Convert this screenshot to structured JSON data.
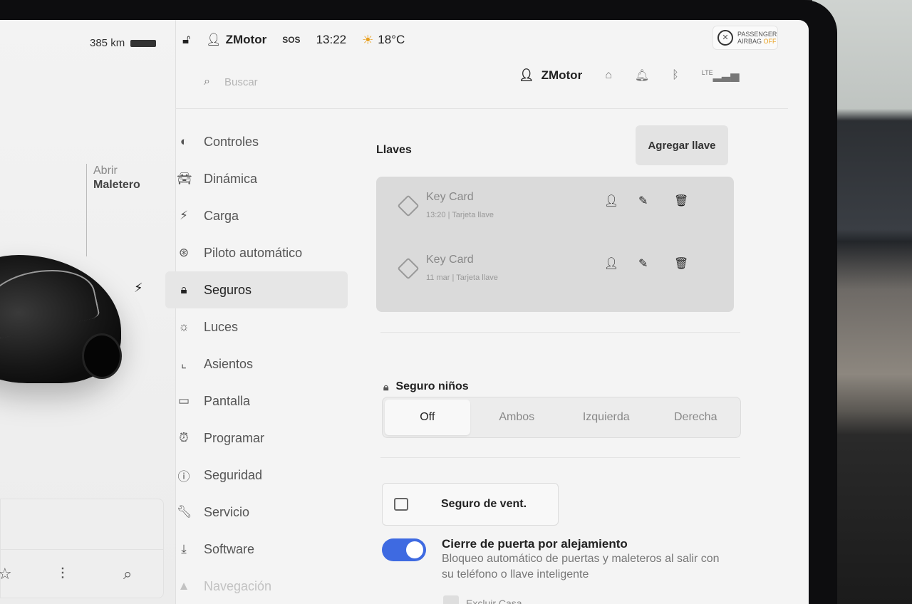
{
  "status": {
    "range": "385 km",
    "user": "ZMotor",
    "sos": "SOS",
    "time": "13:22",
    "temperature": "18°C",
    "airbag_line1": "PASSENGER",
    "airbag_line2": "AIRBAG",
    "airbag_state": "OFF"
  },
  "car": {
    "trunk_label_top": "Abrir",
    "trunk_label_bottom": "Maletero"
  },
  "header": {
    "search_placeholder": "Buscar",
    "user": "ZMotor",
    "network": "LTE"
  },
  "nav": {
    "items": [
      {
        "label": "Controles",
        "icon": "toggle-icon"
      },
      {
        "label": "Dinámica",
        "icon": "car-icon"
      },
      {
        "label": "Carga",
        "icon": "lightning-icon"
      },
      {
        "label": "Piloto automático",
        "icon": "steering-wheel-icon"
      },
      {
        "label": "Seguros",
        "icon": "lock-icon",
        "active": true
      },
      {
        "label": "Luces",
        "icon": "sun-icon"
      },
      {
        "label": "Asientos",
        "icon": "seat-icon"
      },
      {
        "label": "Pantalla",
        "icon": "display-icon"
      },
      {
        "label": "Programar",
        "icon": "alarm-clock-icon"
      },
      {
        "label": "Seguridad",
        "icon": "warning-icon"
      },
      {
        "label": "Servicio",
        "icon": "wrench-icon"
      },
      {
        "label": "Software",
        "icon": "download-icon"
      },
      {
        "label": "Navegación",
        "icon": "navigation-icon"
      }
    ]
  },
  "keys": {
    "title": "Llaves",
    "add_button": "Agregar llave",
    "list": [
      {
        "name": "Key Card",
        "meta": "13:20 | Tarjeta llave"
      },
      {
        "name": "Key Card",
        "meta": "11 mar | Tarjeta llave"
      }
    ]
  },
  "child_lock": {
    "title": "Seguro niños",
    "options": [
      "Off",
      "Ambos",
      "Izquierda",
      "Derecha"
    ],
    "selected": "Off"
  },
  "window_lock": {
    "label": "Seguro de vent."
  },
  "walkaway": {
    "title": "Cierre de puerta por alejamiento",
    "description": "Bloqueo automático de puertas y maleteros al salir con su teléfono o llave inteligente",
    "enabled": true,
    "exclude_home": "Excluir Casa"
  },
  "colors": {
    "toggle_on": "#3e6ae1",
    "weather_sun": "#e8a020"
  }
}
